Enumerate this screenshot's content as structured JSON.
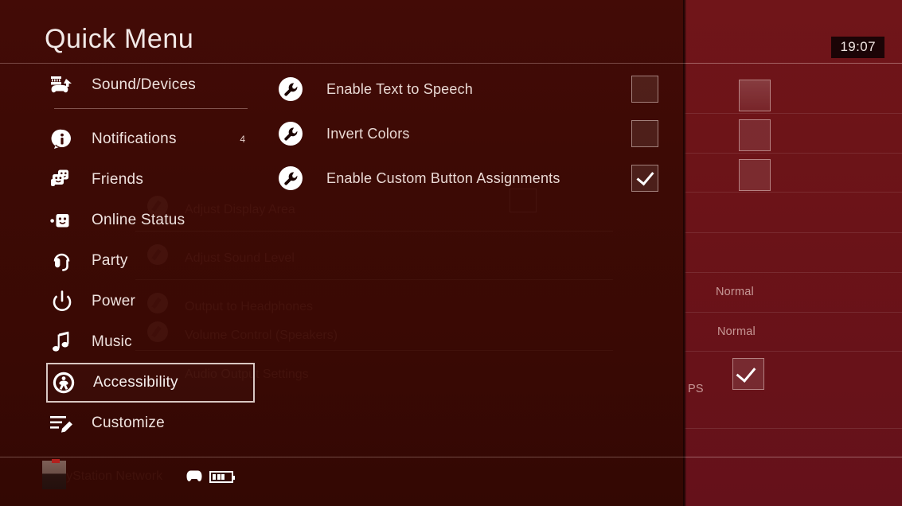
{
  "window": {
    "title": "Quick Menu",
    "clock": "19:07"
  },
  "colors": {
    "overlay_bg": "#3d0a05",
    "background_screen": "#6b1419",
    "text_primary": "#efe2de",
    "text_secondary": "#ead9d4",
    "selection_border": "#d9c7c2",
    "clock_chip_bg": "#1b0406"
  },
  "sidebar": {
    "items": [
      {
        "id": "sound-devices",
        "label": "Sound/Devices",
        "icon": "headset-controller-icon",
        "badge": "",
        "selected": false
      },
      {
        "id": "notifications",
        "label": "Notifications",
        "icon": "info-bubble-icon",
        "badge": "4",
        "selected": false
      },
      {
        "id": "friends",
        "label": "Friends",
        "icon": "friends-icon",
        "badge": "",
        "selected": false
      },
      {
        "id": "online-status",
        "label": "Online Status",
        "icon": "online-status-icon",
        "badge": "",
        "selected": false
      },
      {
        "id": "party",
        "label": "Party",
        "icon": "headset-icon",
        "badge": "",
        "selected": false
      },
      {
        "id": "power",
        "label": "Power",
        "icon": "power-icon",
        "badge": "",
        "selected": false
      },
      {
        "id": "music",
        "label": "Music",
        "icon": "music-note-icon",
        "badge": "",
        "selected": false
      },
      {
        "id": "accessibility",
        "label": "Accessibility",
        "icon": "accessibility-icon",
        "badge": "",
        "selected": true
      },
      {
        "id": "customize",
        "label": "Customize",
        "icon": "customize-pencil-icon",
        "badge": "",
        "selected": false
      }
    ]
  },
  "options": {
    "panel_for": "Accessibility",
    "rows": [
      {
        "id": "enable-text-to-speech",
        "label": "Enable Text to Speech",
        "icon": "wrench-icon",
        "checked": false
      },
      {
        "id": "invert-colors",
        "label": "Invert Colors",
        "icon": "wrench-icon",
        "checked": false
      },
      {
        "id": "enable-custom-button-assignments",
        "label": "Enable Custom Button Assignments",
        "icon": "wrench-icon",
        "checked": true
      }
    ]
  },
  "background_screen": {
    "checkboxes": [
      {
        "id": "bg-check-1",
        "checked": false
      },
      {
        "id": "bg-check-2",
        "checked": false
      },
      {
        "id": "bg-check-3",
        "checked": false
      },
      {
        "id": "bg-check-4",
        "checked": true
      }
    ],
    "values": [
      {
        "id": "bg-value-1",
        "text": "Normal"
      },
      {
        "id": "bg-value-2",
        "text": "Normal"
      }
    ],
    "partial_label": "PS"
  },
  "footer": {
    "avatar": "user-avatar",
    "controller_icon": "controller-icon",
    "battery_icon": "battery-icon"
  }
}
